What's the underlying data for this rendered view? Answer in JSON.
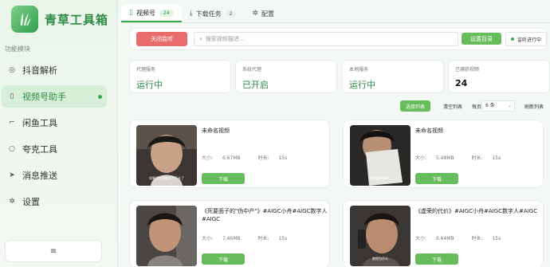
{
  "app": {
    "title": "青草工具箱"
  },
  "sidebar": {
    "section_label": "功能模块",
    "items": [
      {
        "label": "抖音解析"
      },
      {
        "label": "视频号助手"
      },
      {
        "label": "闲鱼工具"
      },
      {
        "label": "夸克工具"
      },
      {
        "label": "消息推送"
      },
      {
        "label": "设置"
      }
    ],
    "menu_glyph": "≡"
  },
  "tabs": [
    {
      "label": "视频号",
      "badge": "24"
    },
    {
      "label": "下载任务",
      "badge": "2"
    },
    {
      "label": "配置"
    }
  ],
  "toolbar": {
    "stop_label": "关闭监听",
    "search_placeholder": "搜索视频描述...",
    "dir_label": "设置目录",
    "listen_status": "监听进行中"
  },
  "stats": [
    {
      "label": "代理服务",
      "value": "运行中"
    },
    {
      "label": "系统代理",
      "value": "已开启"
    },
    {
      "label": "本地服务",
      "value": "运行中"
    },
    {
      "label": "已捕获视频",
      "value": "24"
    }
  ],
  "list_controls": {
    "select_label": "选择列表",
    "clear_label": "清空列表",
    "per_page_label": "每页",
    "per_page_value": "6 条",
    "refresh_label": "刷新列表"
  },
  "videos": [
    {
      "title": "未命名视频",
      "size": "6.67MB",
      "duration": "15s",
      "subtitle": "如果没你我都活不下去了",
      "download": "下载"
    },
    {
      "title": "未命名视频",
      "size": "5.48MB",
      "duration": "15s",
      "subtitle": "你还要这样吗?",
      "download": "下载"
    },
    {
      "title": "《死要面子的\"伪中产\"》#AIGC小舟#AIGC数字人#AIGC",
      "size": "7.46MB",
      "duration": "15s",
      "subtitle": "",
      "download": "下载"
    },
    {
      "title": "《虚荣的代价》#AIGC小舟#AIGC数字人#AIGC",
      "size": "6.64MB",
      "duration": "15s",
      "subtitle": "那你为什么",
      "download": "下载"
    }
  ],
  "labels": {
    "size_prefix": "大小:",
    "duration_prefix": "时长:"
  }
}
